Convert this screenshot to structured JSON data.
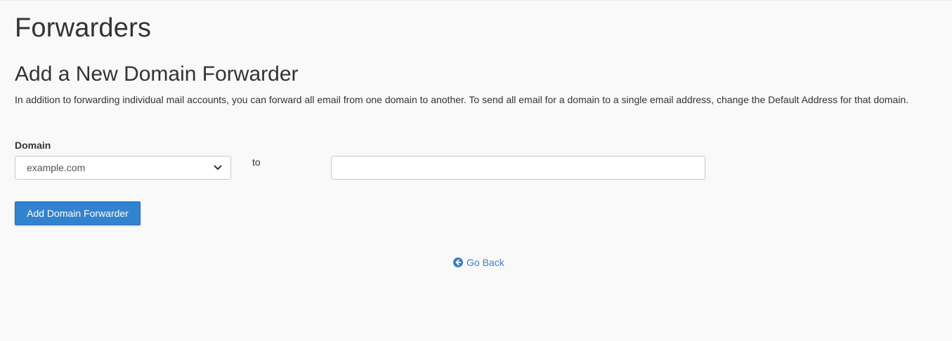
{
  "page": {
    "title": "Forwarders"
  },
  "section": {
    "heading": "Add a New Domain Forwarder",
    "description": "In addition to forwarding individual mail accounts, you can forward all email from one domain to another. To send all email for a domain to a single email address, change the Default Address for that domain."
  },
  "form": {
    "domain_label": "Domain",
    "domain_selected": "example.com",
    "to_label": "to",
    "destination_value": "",
    "submit_label": "Add Domain Forwarder"
  },
  "footer": {
    "go_back_label": "Go Back",
    "go_back_icon": "circle-arrow-left-icon"
  },
  "colors": {
    "background": "#f9f9f9",
    "primary_button": "#3283cf",
    "link": "#3a7fc2",
    "text": "#333333"
  }
}
